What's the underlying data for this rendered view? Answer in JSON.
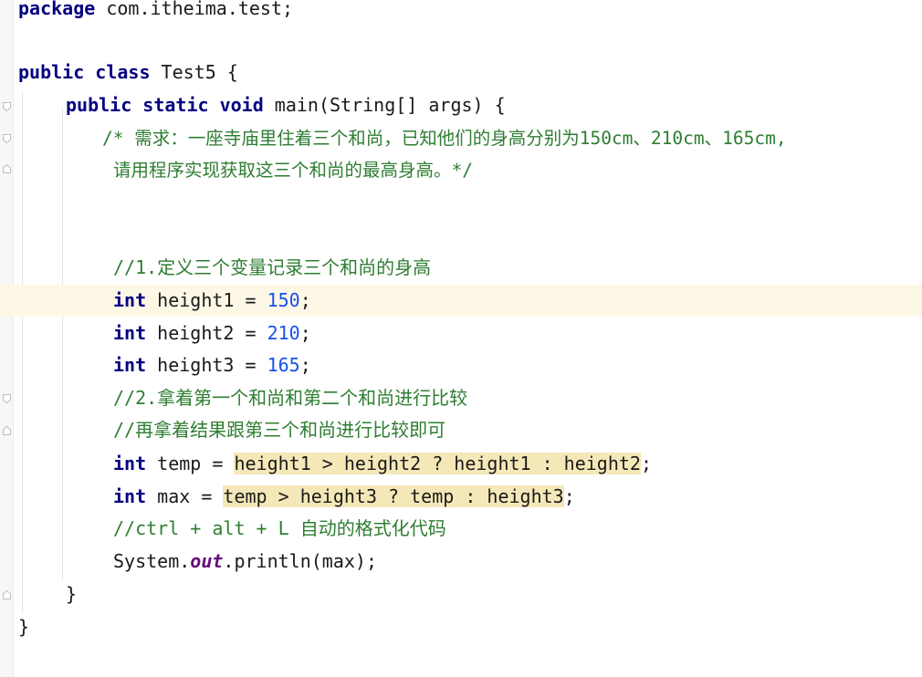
{
  "editor": {
    "language": "Java",
    "lines": {
      "l1": {
        "kw": "package",
        "rest": " com.itheima.test;"
      },
      "l3": {
        "kw1": "public",
        "kw2": "class",
        "rest": " Test5 {"
      },
      "l4": {
        "kw1": "public",
        "kw2": "static",
        "kw3": "void",
        "rest": " main(String[] args) {"
      },
      "l5": {
        "comment": "/* 需求：一座寺庙里住着三个和尚，已知他们的身高分别为150cm、210cm、165cm,"
      },
      "l6": {
        "comment": "请用程序实现获取这三个和尚的最高身高。*/"
      },
      "l9": {
        "comment": "//1.定义三个变量记录三个和尚的身高"
      },
      "l10": {
        "kw": "int",
        "name": " height1 = ",
        "num": "150",
        "end": ";"
      },
      "l11": {
        "kw": "int",
        "name": " height2 = ",
        "num": "210",
        "end": ";"
      },
      "l12": {
        "kw": "int",
        "name": " height3 = ",
        "num": "165",
        "end": ";"
      },
      "l13": {
        "comment": "//2.拿着第一个和尚和第二个和尚进行比较"
      },
      "l14": {
        "comment": "//再拿着结果跟第三个和尚进行比较即可"
      },
      "l15": {
        "kw": "int",
        "pre": " temp = ",
        "hl": "height1 > height2 ? height1 : height2",
        "end": ";"
      },
      "l16": {
        "kw": "int",
        "pre": " max = ",
        "hl": "temp > height3 ? temp : height3",
        "end": ";"
      },
      "l17": {
        "comment": "//ctrl + alt + L 自动的格式化代码"
      },
      "l18": {
        "a": "System.",
        "field": "out",
        "b": ".println(max);"
      },
      "l19": {
        "text": "}"
      },
      "l20": {
        "text": "}"
      }
    },
    "colors": {
      "keyword": "#000080",
      "number": "#1750eb",
      "comment": "#2e7d32",
      "static_field": "#660e7a",
      "current_line": "#fdf8e6",
      "highlight": "#f5e8b8"
    }
  }
}
